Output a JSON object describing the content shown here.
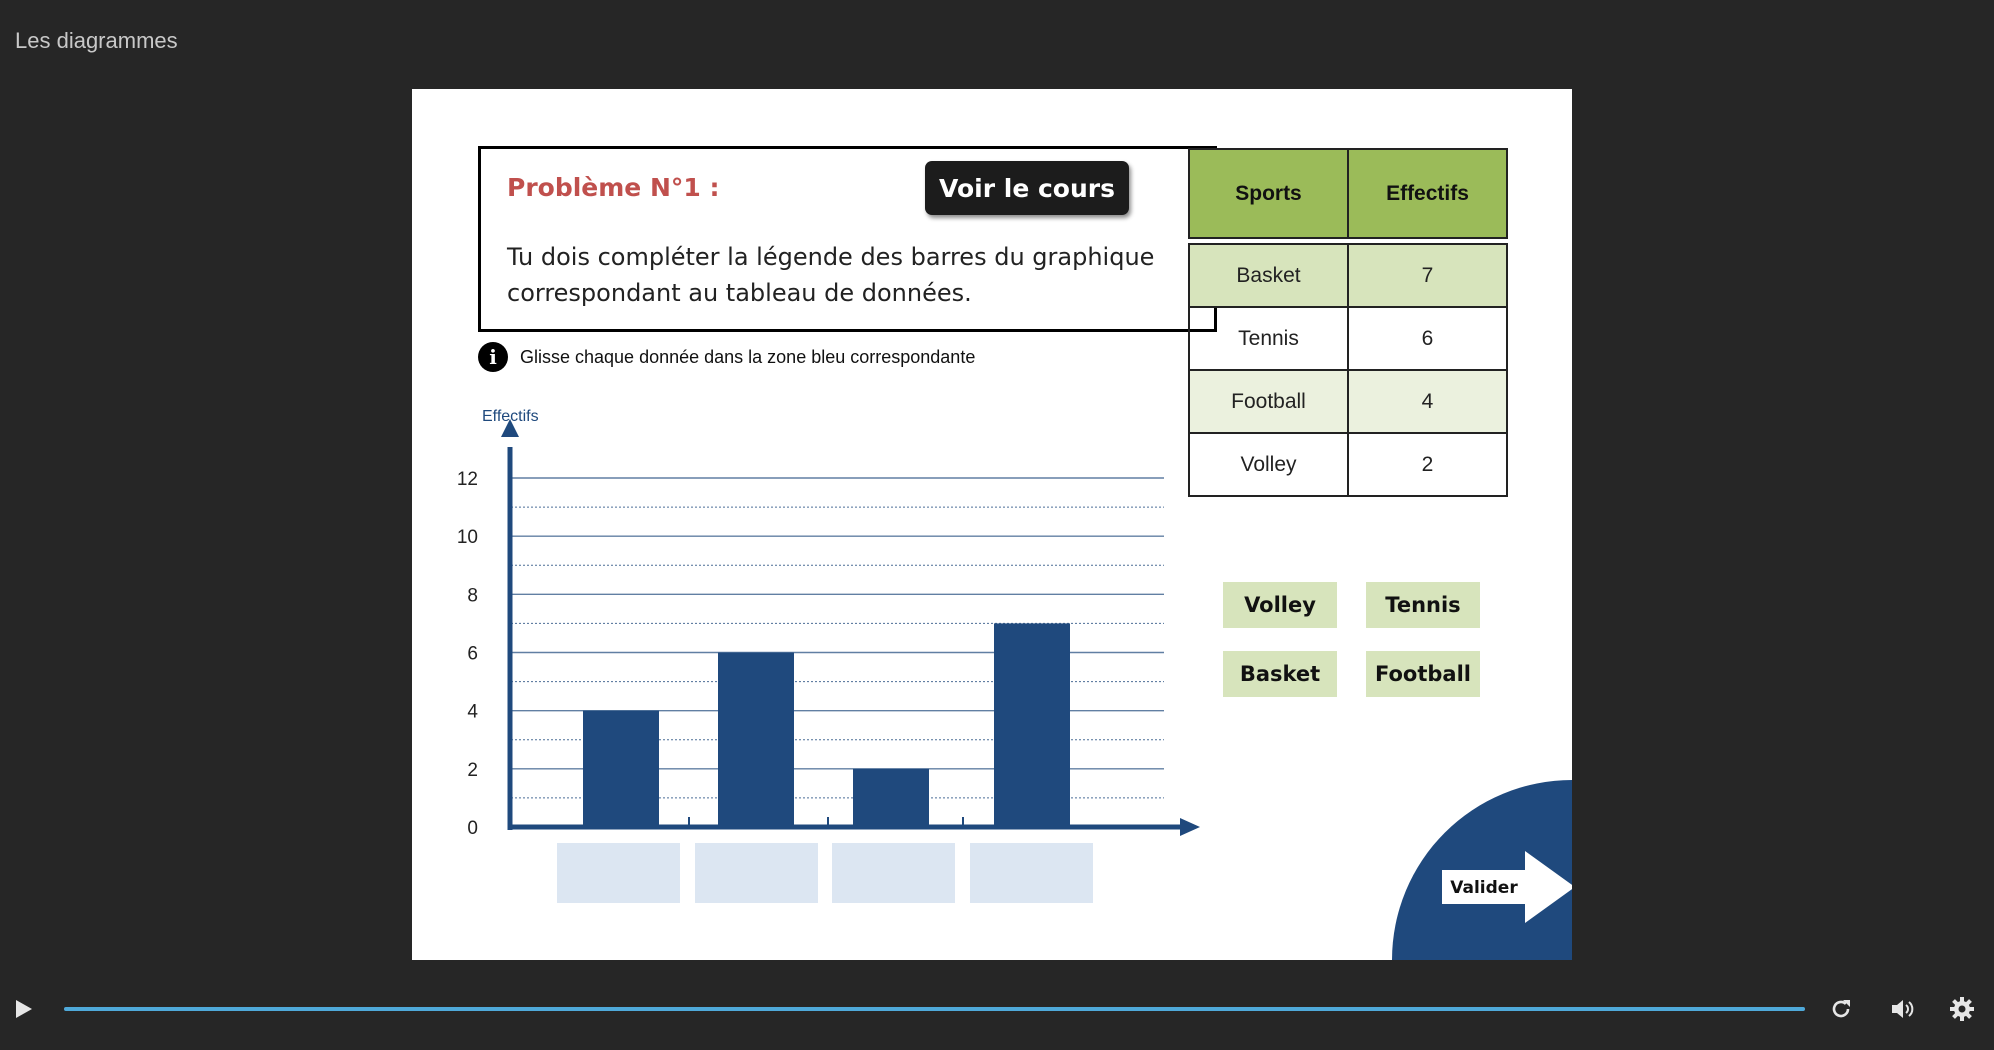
{
  "app": {
    "title": "Les diagrammes"
  },
  "problem": {
    "title": "Problème N°1 :",
    "button_label": "Voir le cours",
    "text": "Tu dois compléter la légende des barres du graphique correspondant au tableau de données.",
    "hint": "Glisse chaque donnée dans la zone bleu correspondante",
    "info_icon_glyph": "i"
  },
  "chart_data": {
    "type": "bar",
    "ylabel": "Effectifs",
    "xlabel": "",
    "ylim": [
      0,
      12
    ],
    "y_ticks": [
      0,
      2,
      4,
      6,
      8,
      10,
      12
    ],
    "values": [
      4,
      6,
      2,
      7
    ],
    "categories": [
      "",
      "",
      "",
      ""
    ],
    "bar_color": "#1f497d",
    "grid": true
  },
  "table": {
    "headers": [
      "Sports",
      "Effectifs"
    ],
    "rows": [
      [
        "Basket",
        "7"
      ],
      [
        "Tennis",
        "6"
      ],
      [
        "Football",
        "4"
      ],
      [
        "Volley",
        "2"
      ]
    ]
  },
  "labels": [
    "Volley",
    "Tennis",
    "Basket",
    "Football"
  ],
  "validate": {
    "label": "Valider"
  },
  "player": {
    "progress": 1.0,
    "accent": "#4fa9d9"
  },
  "colors": {
    "header_green": "#9bbb59",
    "chip_green": "#d7e4bc",
    "drop_blue": "#dce6f2",
    "navy": "#1f497d",
    "problem_red": "#c0504d"
  },
  "icons": {
    "play": "play-icon",
    "replay": "replay-icon",
    "volume": "volume-icon",
    "settings": "gear-icon"
  }
}
